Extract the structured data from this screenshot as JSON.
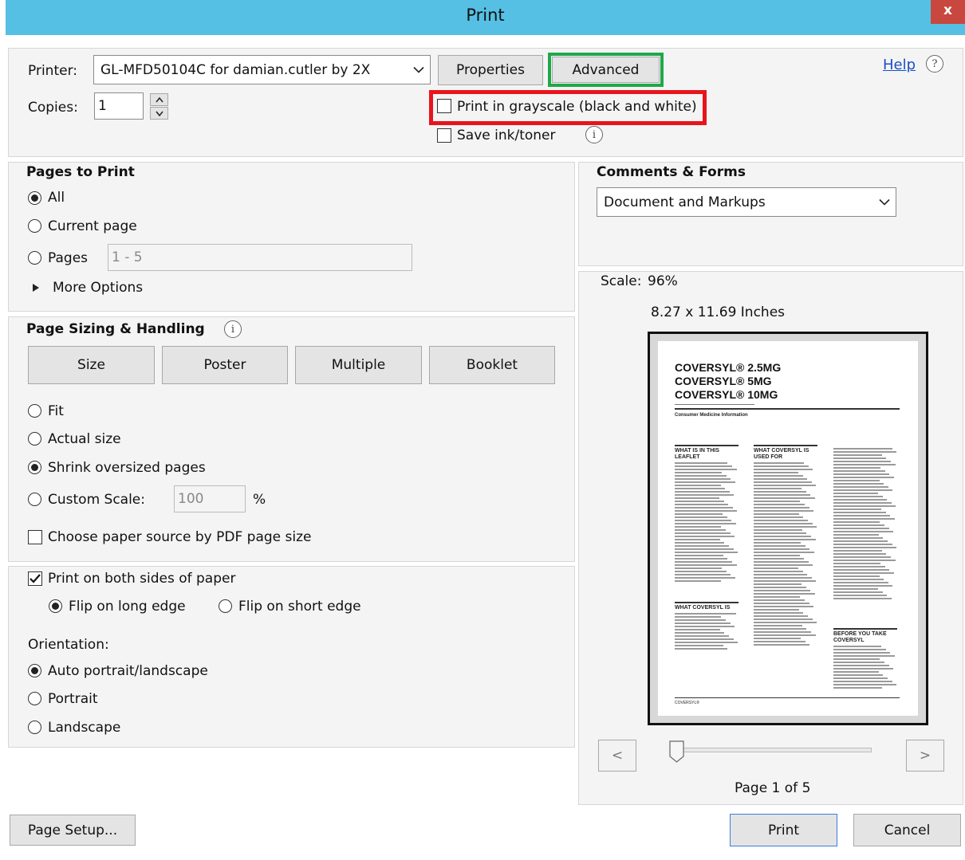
{
  "window": {
    "title": "Print",
    "close_glyph": "x"
  },
  "top": {
    "printer_label": "Printer:",
    "printer_value": "GL-MFD50104C for damian.cutler by 2X",
    "properties_label": "Properties",
    "advanced_label": "Advanced",
    "help_label": "Help",
    "help_glyph": "?",
    "copies_label": "Copies:",
    "copies_value": "1",
    "grayscale_label": "Print in grayscale (black and white)",
    "grayscale_checked": false,
    "save_ink_label": "Save ink/toner",
    "save_ink_checked": false,
    "info_glyph": "i",
    "highlight_colors": {
      "advanced": "#1fa84a",
      "grayscale": "#e8141b"
    }
  },
  "pages_to_print": {
    "header": "Pages to Print",
    "all_label": "All",
    "current_label": "Current page",
    "pages_label": "Pages",
    "pages_value": "1 - 5",
    "more_options_label": "More Options",
    "selected": "All"
  },
  "page_sizing": {
    "header": "Page Sizing & Handling",
    "tabs": [
      "Size",
      "Poster",
      "Multiple",
      "Booklet"
    ],
    "fit_label": "Fit",
    "actual_label": "Actual size",
    "shrink_label": "Shrink oversized pages",
    "custom_label": "Custom Scale:",
    "custom_value": "100",
    "percent": "%",
    "paper_source_label": "Choose paper source by PDF page size",
    "selected": "Shrink oversized pages"
  },
  "duplex": {
    "both_sides_label": "Print on both sides of paper",
    "both_sides_checked": true,
    "long_edge_label": "Flip on long edge",
    "short_edge_label": "Flip on short edge",
    "flip_selected": "long",
    "orientation_label": "Orientation:",
    "auto_label": "Auto portrait/landscape",
    "portrait_label": "Portrait",
    "landscape_label": "Landscape",
    "orientation_selected": "auto"
  },
  "comments": {
    "header": "Comments & Forms",
    "value": "Document and Markups"
  },
  "preview": {
    "scale_label": "Scale:",
    "scale_value": "96%",
    "size_text": "8.27 x 11.69 Inches",
    "doc_title_lines": [
      "COVERSYL® 2.5MG",
      "COVERSYL® 5MG",
      "COVERSYL® 10MG"
    ],
    "doc_subtitle": "Consumer Medicine Information",
    "col_heads": [
      "WHAT IS IN THIS LEAFLET",
      "WHAT COVERSYL IS USED FOR",
      "WHAT COVERSYL IS",
      "BEFORE YOU TAKE COVERSYL"
    ],
    "doc_footer": "COVERSYL®",
    "prev_glyph": "<",
    "next_glyph": ">",
    "page_indicator": "Page 1 of 5",
    "slider_position": 0
  },
  "bottom": {
    "page_setup_label": "Page Setup...",
    "print_label": "Print",
    "cancel_label": "Cancel"
  }
}
